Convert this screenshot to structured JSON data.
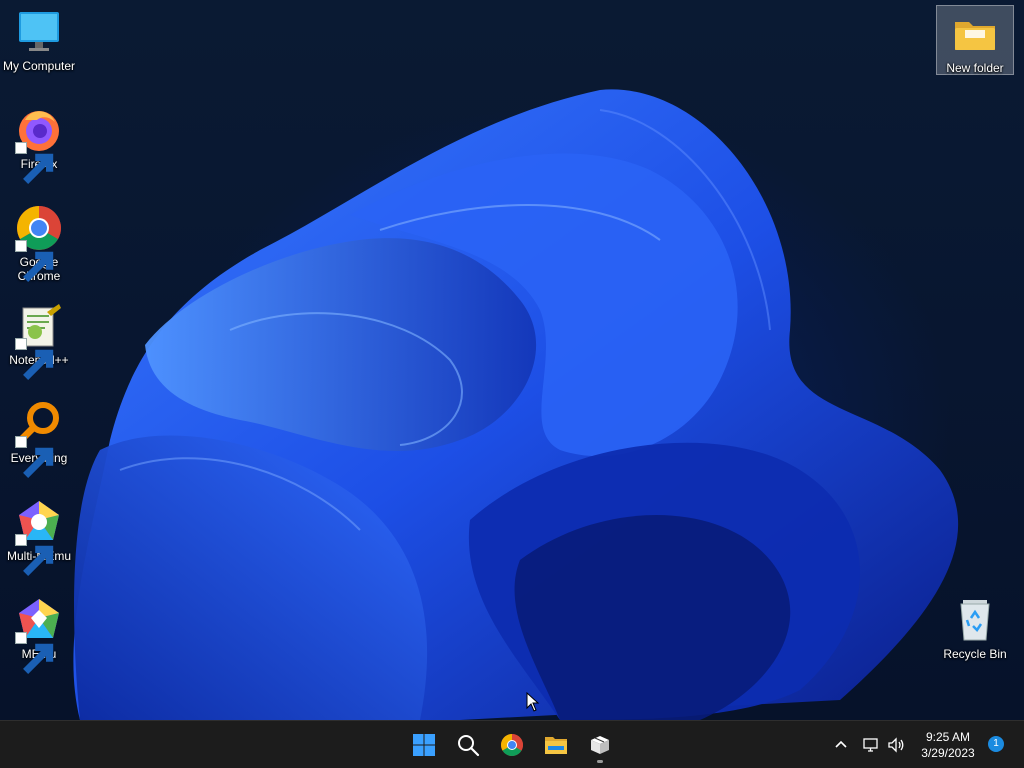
{
  "desktop": {
    "icons": [
      {
        "id": "my-computer",
        "label": "My Computer",
        "icon": "monitor-icon",
        "shortcut": false
      },
      {
        "id": "firefox",
        "label": "Firefox",
        "icon": "firefox-icon",
        "shortcut": true
      },
      {
        "id": "chrome",
        "label": "Google Chrome",
        "icon": "chrome-icon",
        "shortcut": true
      },
      {
        "id": "notepadpp",
        "label": "Notepad++",
        "icon": "notepadpp-icon",
        "shortcut": true
      },
      {
        "id": "everything",
        "label": "Everything",
        "icon": "everything-icon",
        "shortcut": true
      },
      {
        "id": "multi-memu",
        "label": "Multi-MEmu",
        "icon": "multi-memu-icon",
        "shortcut": true
      },
      {
        "id": "memu",
        "label": "MEmu",
        "icon": "memu-icon",
        "shortcut": true
      },
      {
        "id": "new-folder",
        "label": "New folder",
        "icon": "folder-icon",
        "shortcut": false,
        "selected": true
      },
      {
        "id": "recycle-bin",
        "label": "Recycle Bin",
        "icon": "recycle-bin-icon",
        "shortcut": false
      }
    ]
  },
  "taskbar": {
    "pinned": [
      {
        "id": "start",
        "icon": "windows-start-icon"
      },
      {
        "id": "search",
        "icon": "search-icon"
      },
      {
        "id": "chrome",
        "icon": "chrome-icon"
      },
      {
        "id": "file-explorer",
        "icon": "file-explorer-icon"
      },
      {
        "id": "package-app",
        "icon": "package-box-icon",
        "running": true
      }
    ],
    "tray": {
      "icons": [
        "chevron-up-icon",
        "network-icon",
        "volume-icon"
      ],
      "time": "9:25 AM",
      "date": "3/29/2023",
      "notifications": "1"
    }
  },
  "colors": {
    "accent": "#1b8be0",
    "taskbar": "#1c1c1c",
    "wallpaper_blue": "#1f4fe0",
    "folder_yellow": "#f5c542"
  }
}
